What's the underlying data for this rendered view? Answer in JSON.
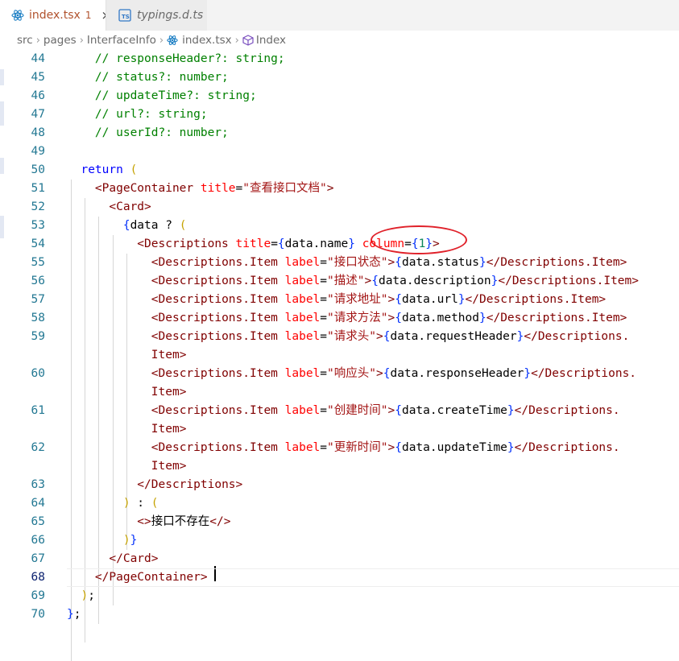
{
  "tabs": [
    {
      "label": "index.tsx",
      "badge": "1",
      "close": "×",
      "icon": "react-icon",
      "color": "#b1522d"
    },
    {
      "label": "typings.d.ts",
      "icon": "ts-icon"
    }
  ],
  "breadcrumb": {
    "src": "src",
    "pages": "pages",
    "folder": "InterfaceInfo",
    "file": "index.tsx",
    "symbol": "Index"
  },
  "editor": {
    "current_line": "68",
    "lines": [
      {
        "n": "44",
        "tokens": [
          {
            "t": "    // responseHeader?: string;",
            "c": "com"
          }
        ]
      },
      {
        "n": "45",
        "tokens": [
          {
            "t": "    // status?: number;",
            "c": "com"
          }
        ]
      },
      {
        "n": "46",
        "tokens": [
          {
            "t": "    // updateTime?: string;",
            "c": "com"
          }
        ]
      },
      {
        "n": "47",
        "tokens": [
          {
            "t": "    // url?: string;",
            "c": "com"
          }
        ]
      },
      {
        "n": "48",
        "tokens": [
          {
            "t": "    // userId?: number;",
            "c": "com"
          }
        ]
      },
      {
        "n": "49",
        "tokens": []
      },
      {
        "n": "50",
        "tokens": [
          {
            "t": "  ",
            "c": "pl"
          },
          {
            "t": "return",
            "c": "kw"
          },
          {
            "t": " ",
            "c": "pl"
          },
          {
            "t": "(",
            "c": "b4"
          }
        ]
      },
      {
        "n": "51",
        "tokens": [
          {
            "t": "    <",
            "c": "tag"
          },
          {
            "t": "PageContainer",
            "c": "tag"
          },
          {
            "t": " ",
            "c": "pl"
          },
          {
            "t": "title",
            "c": "attr"
          },
          {
            "t": "=",
            "c": "pl"
          },
          {
            "t": "\"查看接口文档\"",
            "c": "str"
          },
          {
            "t": ">",
            "c": "tag"
          }
        ]
      },
      {
        "n": "52",
        "tokens": [
          {
            "t": "      <",
            "c": "tag"
          },
          {
            "t": "Card",
            "c": "tag"
          },
          {
            "t": ">",
            "c": "tag"
          }
        ]
      },
      {
        "n": "53",
        "tokens": [
          {
            "t": "        ",
            "c": "pl"
          },
          {
            "t": "{",
            "c": "b1"
          },
          {
            "t": "data",
            "c": "pl"
          },
          {
            "t": " ? ",
            "c": "pl"
          },
          {
            "t": "(",
            "c": "b4"
          }
        ]
      },
      {
        "n": "54",
        "tokens": [
          {
            "t": "          <",
            "c": "tag"
          },
          {
            "t": "Descriptions",
            "c": "tag"
          },
          {
            "t": " ",
            "c": "pl"
          },
          {
            "t": "title",
            "c": "attr"
          },
          {
            "t": "=",
            "c": "pl"
          },
          {
            "t": "{",
            "c": "b1"
          },
          {
            "t": "data.name",
            "c": "pl"
          },
          {
            "t": "}",
            "c": "b1"
          },
          {
            "t": " ",
            "c": "pl"
          },
          {
            "t": "column",
            "c": "attr"
          },
          {
            "t": "=",
            "c": "pl"
          },
          {
            "t": "{",
            "c": "b1"
          },
          {
            "t": "1",
            "c": "num"
          },
          {
            "t": "}",
            "c": "b1"
          },
          {
            "t": ">",
            "c": "tag"
          }
        ]
      },
      {
        "n": "55",
        "tokens": [
          {
            "t": "            <",
            "c": "tag"
          },
          {
            "t": "Descriptions.Item",
            "c": "tag"
          },
          {
            "t": " ",
            "c": "pl"
          },
          {
            "t": "label",
            "c": "attr"
          },
          {
            "t": "=",
            "c": "pl"
          },
          {
            "t": "\"接口状态\"",
            "c": "str"
          },
          {
            "t": ">",
            "c": "tag"
          },
          {
            "t": "{",
            "c": "b1"
          },
          {
            "t": "data.status",
            "c": "pl"
          },
          {
            "t": "}",
            "c": "b1"
          },
          {
            "t": "</",
            "c": "tag"
          },
          {
            "t": "Descriptions.Item",
            "c": "tag"
          },
          {
            "t": ">",
            "c": "tag"
          }
        ]
      },
      {
        "n": "56",
        "tokens": [
          {
            "t": "            <",
            "c": "tag"
          },
          {
            "t": "Descriptions.Item",
            "c": "tag"
          },
          {
            "t": " ",
            "c": "pl"
          },
          {
            "t": "label",
            "c": "attr"
          },
          {
            "t": "=",
            "c": "pl"
          },
          {
            "t": "\"描述\"",
            "c": "str"
          },
          {
            "t": ">",
            "c": "tag"
          },
          {
            "t": "{",
            "c": "b1"
          },
          {
            "t": "data.description",
            "c": "pl"
          },
          {
            "t": "}",
            "c": "b1"
          },
          {
            "t": "</",
            "c": "tag"
          },
          {
            "t": "Descriptions.Item",
            "c": "tag"
          },
          {
            "t": ">",
            "c": "tag"
          }
        ]
      },
      {
        "n": "57",
        "tokens": [
          {
            "t": "            <",
            "c": "tag"
          },
          {
            "t": "Descriptions.Item",
            "c": "tag"
          },
          {
            "t": " ",
            "c": "pl"
          },
          {
            "t": "label",
            "c": "attr"
          },
          {
            "t": "=",
            "c": "pl"
          },
          {
            "t": "\"请求地址\"",
            "c": "str"
          },
          {
            "t": ">",
            "c": "tag"
          },
          {
            "t": "{",
            "c": "b1"
          },
          {
            "t": "data.url",
            "c": "pl"
          },
          {
            "t": "}",
            "c": "b1"
          },
          {
            "t": "</",
            "c": "tag"
          },
          {
            "t": "Descriptions.Item",
            "c": "tag"
          },
          {
            "t": ">",
            "c": "tag"
          }
        ]
      },
      {
        "n": "58",
        "tokens": [
          {
            "t": "            <",
            "c": "tag"
          },
          {
            "t": "Descriptions.Item",
            "c": "tag"
          },
          {
            "t": " ",
            "c": "pl"
          },
          {
            "t": "label",
            "c": "attr"
          },
          {
            "t": "=",
            "c": "pl"
          },
          {
            "t": "\"请求方法\"",
            "c": "str"
          },
          {
            "t": ">",
            "c": "tag"
          },
          {
            "t": "{",
            "c": "b1"
          },
          {
            "t": "data.method",
            "c": "pl"
          },
          {
            "t": "}",
            "c": "b1"
          },
          {
            "t": "</",
            "c": "tag"
          },
          {
            "t": "Descriptions.Item",
            "c": "tag"
          },
          {
            "t": ">",
            "c": "tag"
          }
        ]
      },
      {
        "n": "59",
        "tokens": [
          {
            "t": "            <",
            "c": "tag"
          },
          {
            "t": "Descriptions.Item",
            "c": "tag"
          },
          {
            "t": " ",
            "c": "pl"
          },
          {
            "t": "label",
            "c": "attr"
          },
          {
            "t": "=",
            "c": "pl"
          },
          {
            "t": "\"请求头\"",
            "c": "str"
          },
          {
            "t": ">",
            "c": "tag"
          },
          {
            "t": "{",
            "c": "b1"
          },
          {
            "t": "data.requestHeader",
            "c": "pl"
          },
          {
            "t": "}",
            "c": "b1"
          },
          {
            "t": "</",
            "c": "tag"
          },
          {
            "t": "Descriptions.",
            "c": "tag"
          }
        ]
      },
      {
        "n": "",
        "tokens": [
          {
            "t": "            Item",
            "c": "tag"
          },
          {
            "t": ">",
            "c": "tag"
          }
        ]
      },
      {
        "n": "60",
        "tokens": [
          {
            "t": "            <",
            "c": "tag"
          },
          {
            "t": "Descriptions.Item",
            "c": "tag"
          },
          {
            "t": " ",
            "c": "pl"
          },
          {
            "t": "label",
            "c": "attr"
          },
          {
            "t": "=",
            "c": "pl"
          },
          {
            "t": "\"响应头\"",
            "c": "str"
          },
          {
            "t": ">",
            "c": "tag"
          },
          {
            "t": "{",
            "c": "b1"
          },
          {
            "t": "data.responseHeader",
            "c": "pl"
          },
          {
            "t": "}",
            "c": "b1"
          },
          {
            "t": "</",
            "c": "tag"
          },
          {
            "t": "Descriptions.",
            "c": "tag"
          }
        ]
      },
      {
        "n": "",
        "tokens": [
          {
            "t": "            Item",
            "c": "tag"
          },
          {
            "t": ">",
            "c": "tag"
          }
        ]
      },
      {
        "n": "61",
        "tokens": [
          {
            "t": "            <",
            "c": "tag"
          },
          {
            "t": "Descriptions.Item",
            "c": "tag"
          },
          {
            "t": " ",
            "c": "pl"
          },
          {
            "t": "label",
            "c": "attr"
          },
          {
            "t": "=",
            "c": "pl"
          },
          {
            "t": "\"创建时间\"",
            "c": "str"
          },
          {
            "t": ">",
            "c": "tag"
          },
          {
            "t": "{",
            "c": "b1"
          },
          {
            "t": "data.createTime",
            "c": "pl"
          },
          {
            "t": "}",
            "c": "b1"
          },
          {
            "t": "</",
            "c": "tag"
          },
          {
            "t": "Descriptions.",
            "c": "tag"
          }
        ]
      },
      {
        "n": "",
        "tokens": [
          {
            "t": "            Item",
            "c": "tag"
          },
          {
            "t": ">",
            "c": "tag"
          }
        ]
      },
      {
        "n": "62",
        "tokens": [
          {
            "t": "            <",
            "c": "tag"
          },
          {
            "t": "Descriptions.Item",
            "c": "tag"
          },
          {
            "t": " ",
            "c": "pl"
          },
          {
            "t": "label",
            "c": "attr"
          },
          {
            "t": "=",
            "c": "pl"
          },
          {
            "t": "\"更新时间\"",
            "c": "str"
          },
          {
            "t": ">",
            "c": "tag"
          },
          {
            "t": "{",
            "c": "b1"
          },
          {
            "t": "data.updateTime",
            "c": "pl"
          },
          {
            "t": "}",
            "c": "b1"
          },
          {
            "t": "</",
            "c": "tag"
          },
          {
            "t": "Descriptions.",
            "c": "tag"
          }
        ]
      },
      {
        "n": "",
        "tokens": [
          {
            "t": "            Item",
            "c": "tag"
          },
          {
            "t": ">",
            "c": "tag"
          }
        ]
      },
      {
        "n": "63",
        "tokens": [
          {
            "t": "          </",
            "c": "tag"
          },
          {
            "t": "Descriptions",
            "c": "tag"
          },
          {
            "t": ">",
            "c": "tag"
          }
        ]
      },
      {
        "n": "64",
        "tokens": [
          {
            "t": "        ",
            "c": "pl"
          },
          {
            "t": ")",
            "c": "b4"
          },
          {
            "t": " : ",
            "c": "pl"
          },
          {
            "t": "(",
            "c": "b4"
          }
        ]
      },
      {
        "n": "65",
        "tokens": [
          {
            "t": "          <>",
            "c": "tag"
          },
          {
            "t": "接口不存在",
            "c": "pl"
          },
          {
            "t": "</>",
            "c": "tag"
          }
        ]
      },
      {
        "n": "66",
        "tokens": [
          {
            "t": "        ",
            "c": "pl"
          },
          {
            "t": ")",
            "c": "b4"
          },
          {
            "t": "}",
            "c": "b1"
          }
        ]
      },
      {
        "n": "67",
        "tokens": [
          {
            "t": "      </",
            "c": "tag"
          },
          {
            "t": "Card",
            "c": "tag"
          },
          {
            "t": ">",
            "c": "tag"
          }
        ]
      },
      {
        "n": "68",
        "tokens": [
          {
            "t": "    </",
            "c": "tag"
          },
          {
            "t": "PageContainer",
            "c": "tag"
          },
          {
            "t": ">",
            "c": "tag"
          }
        ]
      },
      {
        "n": "69",
        "tokens": [
          {
            "t": "  ",
            "c": "pl"
          },
          {
            "t": ")",
            "c": "b4"
          },
          {
            "t": ";",
            "c": "pl"
          }
        ]
      },
      {
        "n": "70",
        "tokens": [
          {
            "t": "}",
            "c": "b1"
          },
          {
            "t": ";",
            "c": "pl"
          }
        ]
      }
    ]
  }
}
